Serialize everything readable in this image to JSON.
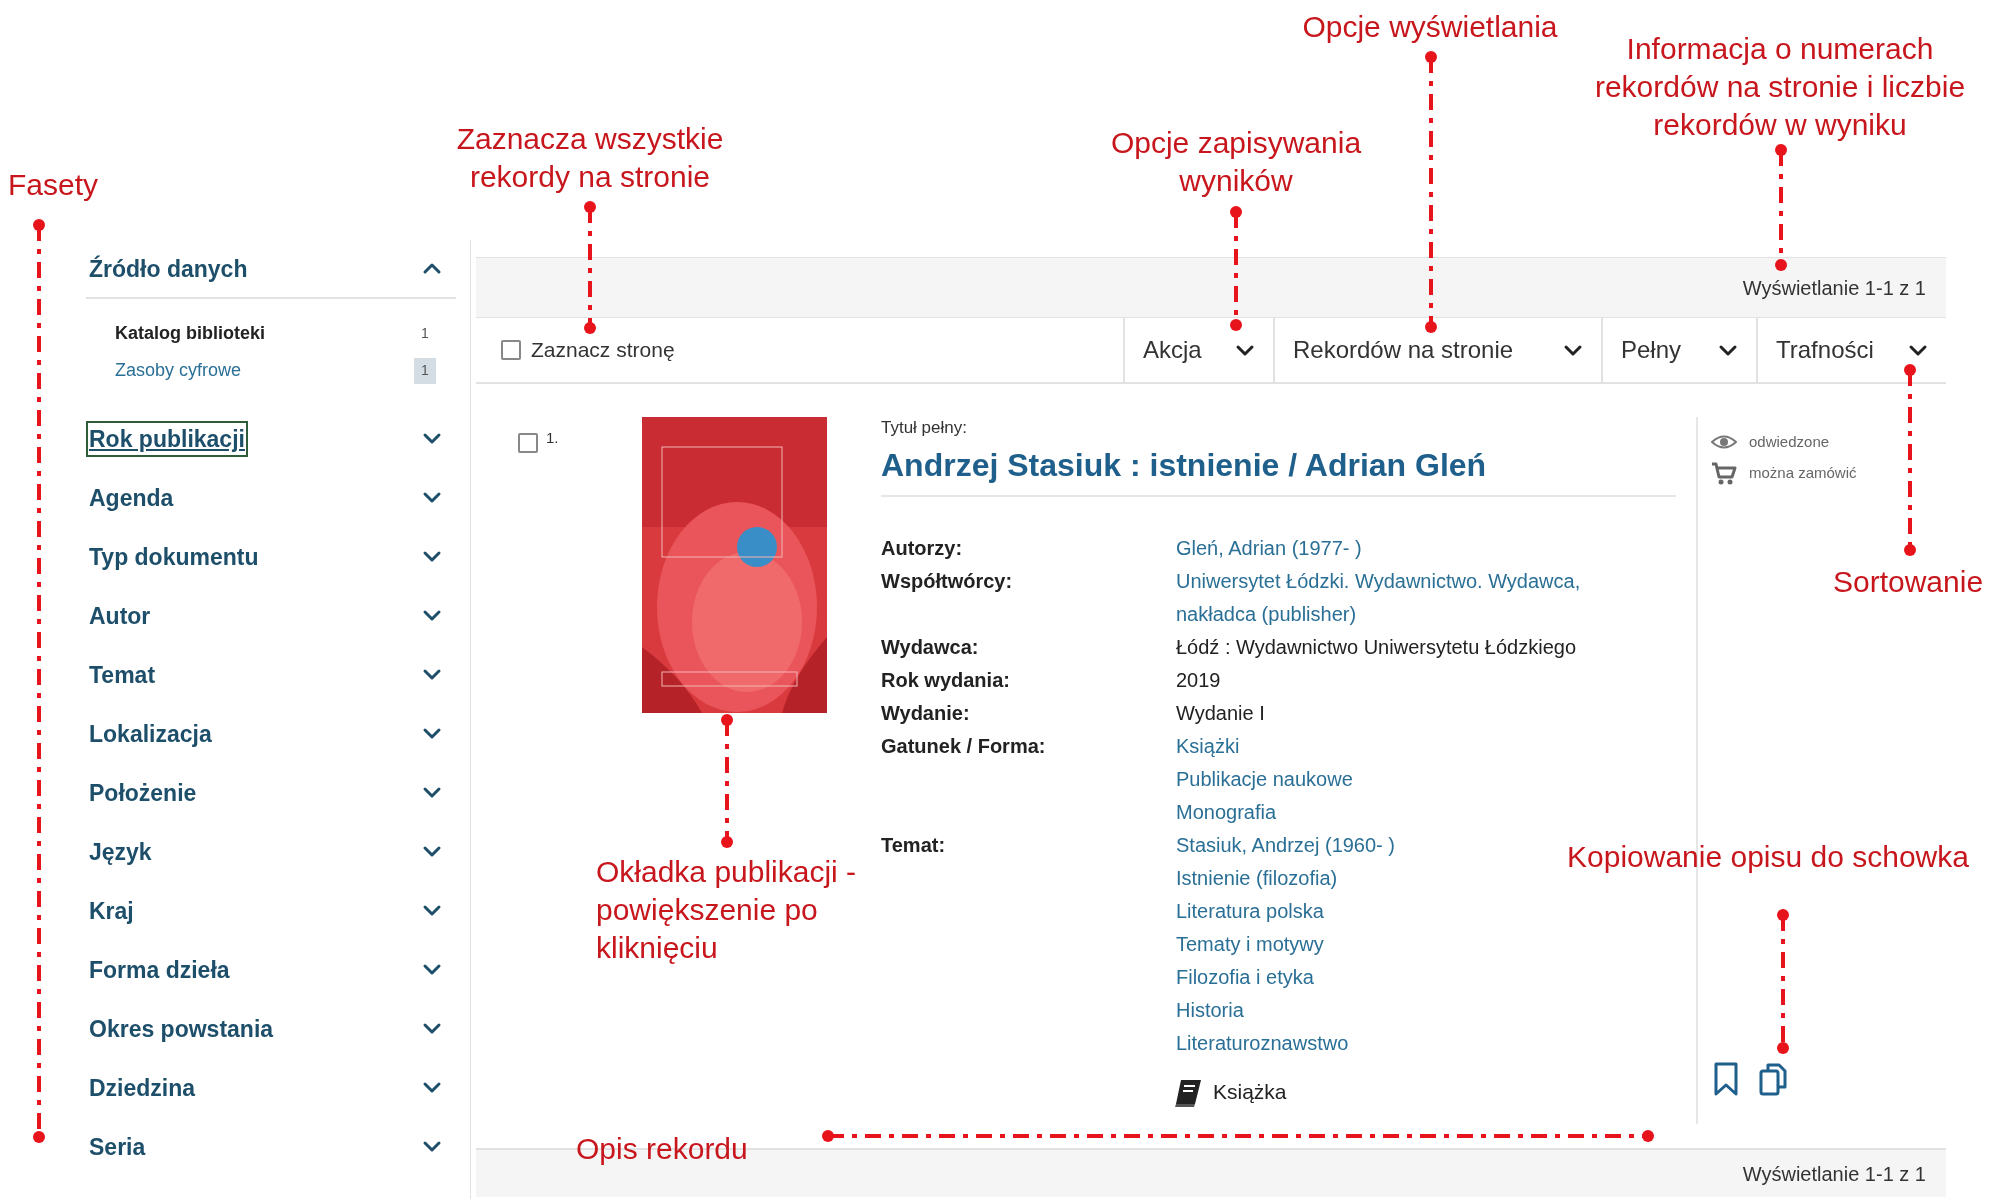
{
  "facets": [
    {
      "label": "Źródło danych",
      "expanded": true,
      "focused": false,
      "items": [
        {
          "label": "Katalog biblioteki",
          "count": "1",
          "selected": true,
          "highlighted": false
        },
        {
          "label": "Zasoby cyfrowe",
          "count": "1",
          "selected": false,
          "highlighted": true
        }
      ]
    },
    {
      "label": "Rok publikacji",
      "expanded": false,
      "focused": true
    },
    {
      "label": "Agenda",
      "expanded": false,
      "focused": false
    },
    {
      "label": "Typ dokumentu",
      "expanded": false,
      "focused": false
    },
    {
      "label": "Autor",
      "expanded": false,
      "focused": false
    },
    {
      "label": "Temat",
      "expanded": false,
      "focused": false
    },
    {
      "label": "Lokalizacja",
      "expanded": false,
      "focused": false
    },
    {
      "label": "Położenie",
      "expanded": false,
      "focused": false
    },
    {
      "label": "Język",
      "expanded": false,
      "focused": false
    },
    {
      "label": "Kraj",
      "expanded": false,
      "focused": false
    },
    {
      "label": "Forma dzieła",
      "expanded": false,
      "focused": false
    },
    {
      "label": "Okres powstania",
      "expanded": false,
      "focused": false
    },
    {
      "label": "Dziedzina",
      "expanded": false,
      "focused": false
    },
    {
      "label": "Seria",
      "expanded": false,
      "focused": false
    }
  ],
  "results_info_top": "Wyświetlanie 1-1 z 1",
  "toolbar": {
    "select_page": {
      "label": "Zaznacz stronę",
      "checked": false
    },
    "dropdowns": [
      "Akcja",
      "Rekordów na stronie",
      "Pełny",
      "Trafności"
    ]
  },
  "record": {
    "checked": false,
    "number": "1.",
    "title_label": "Tytuł pełny:",
    "title": "Andrzej Stasiuk : istnienie / Adrian Gleń",
    "fields": [
      {
        "label": "Autorzy:",
        "values": [
          {
            "text": "Gleń, Adrian (1977- )",
            "link": true
          }
        ]
      },
      {
        "label": "Współtwórcy:",
        "values": [
          {
            "text": "Uniwersytet Łódzki. Wydawnictwo. Wydawca, nakładca (publisher)",
            "link": true
          }
        ]
      },
      {
        "label": "Wydawca:",
        "values": [
          {
            "text": "Łódź : Wydawnictwo Uniwersytetu Łódzkiego",
            "link": false
          }
        ]
      },
      {
        "label": "Rok wydania:",
        "values": [
          {
            "text": "2019",
            "link": false
          }
        ]
      },
      {
        "label": "Wydanie:",
        "values": [
          {
            "text": "Wydanie I",
            "link": false
          }
        ]
      },
      {
        "label": "Gatunek / Forma:",
        "values": [
          {
            "text": "Książki",
            "link": true
          },
          {
            "text": "Publikacje naukowe",
            "link": true
          },
          {
            "text": "Monografia",
            "link": true
          }
        ]
      },
      {
        "label": "Temat:",
        "values": [
          {
            "text": "Stasiuk, Andrzej (1960- )",
            "link": true
          },
          {
            "text": "Istnienie (filozofia)",
            "link": true
          },
          {
            "text": "Literatura polska",
            "link": true
          },
          {
            "text": "Tematy i motywy",
            "link": true
          },
          {
            "text": "Filozofia i etyka",
            "link": true
          },
          {
            "text": "Historia",
            "link": true
          },
          {
            "text": "Literaturoznawstwo",
            "link": true
          }
        ]
      }
    ],
    "format": "Książka",
    "badges": [
      {
        "kind": "visited",
        "text": "odwiedzone"
      },
      {
        "kind": "orderable",
        "text": "można zamówić"
      }
    ]
  },
  "results_info_bottom": "Wyświetlanie 1-1 z 1",
  "annotations": [
    "Fasety",
    "Zaznacza wszystkie rekordy na stronie",
    "Opcje zapisywania wyników",
    "Opcje wyświetlania",
    "Informacja o numerach rekordów na stronie i liczbie rekordów w wyniku",
    "Sortowanie",
    "Okładka publikacji - powiększenie po kliknięciu",
    "Kopiowanie opisu do schowka",
    "Opis rekordu"
  ]
}
